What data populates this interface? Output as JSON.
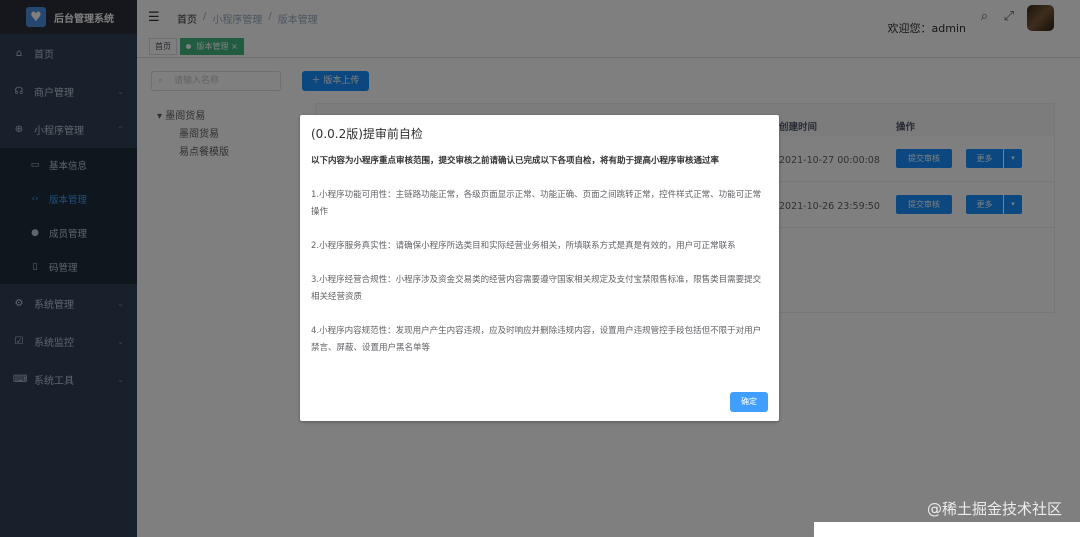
{
  "sidebar": {
    "brand": "后台管理系统",
    "items": [
      {
        "label": "首页",
        "icon": "dashboard-icon",
        "glyph": "⌂"
      },
      {
        "label": "商户管理",
        "icon": "merchant-icon",
        "glyph": "☊"
      },
      {
        "label": "小程序管理",
        "icon": "miniapp-icon",
        "glyph": "⊕"
      }
    ],
    "submenu": [
      {
        "label": "基本信息",
        "glyph": "▭"
      },
      {
        "label": "版本管理",
        "glyph": "‹›"
      },
      {
        "label": "成员管理",
        "glyph": "●"
      },
      {
        "label": "码管理",
        "glyph": "▯"
      }
    ],
    "items_after": [
      {
        "label": "系统管理",
        "glyph": "⚙"
      },
      {
        "label": "系统监控",
        "glyph": "☑"
      },
      {
        "label": "系统工具",
        "glyph": "⌨"
      }
    ]
  },
  "header": {
    "breadcrumb": [
      "首页",
      "/",
      "小程序管理",
      "/",
      "版本管理"
    ],
    "welcome": "欢迎您：admin"
  },
  "tags": {
    "home": "首页",
    "active": "版本管理",
    "close": "×"
  },
  "main": {
    "search_placeholder": "请输入名称",
    "tree": {
      "root": "墨阁货易",
      "children": [
        "墨阁货易",
        "易点餐模版"
      ]
    },
    "upload_button": "版本上传",
    "table": {
      "col_time": "创建时间",
      "col_actions": "操作",
      "rows": [
        {
          "time": "2021-10-27 00:00:08",
          "submit": "提交审核",
          "more": "更多"
        },
        {
          "time": "2021-10-26 23:59:50",
          "submit": "提交审核",
          "more": "更多"
        }
      ]
    }
  },
  "dialog": {
    "title": "(0.0.2版)提审前自检",
    "intro": "以下内容为小程序重点审核范围，提交审核之前请确认已完成以下各项自检，将有助于提高小程序审核通过率",
    "items": [
      "1.小程序功能可用性：主链路功能正常，各级页面显示正常、功能正确、页面之间跳转正常，控件样式正常、功能可正常操作",
      "2.小程序服务真实性：请确保小程序所选类目和实际经营业务相关，所填联系方式是真是有效的，用户可正常联系",
      "3.小程序经营合规性：小程序涉及资金交易类的经营内容需要遵守国家相关规定及支付宝禁限售标准，限售类目需要提交相关经营资质",
      "4.小程序内容规范性：发现用户产生内容违规，应及时响应并删除违规内容，设置用户违规管控手段包括但不限于对用户禁言、屏蔽、设置用户黑名单等"
    ],
    "confirm": "确定"
  },
  "watermark": "@稀土掘金技术社区"
}
